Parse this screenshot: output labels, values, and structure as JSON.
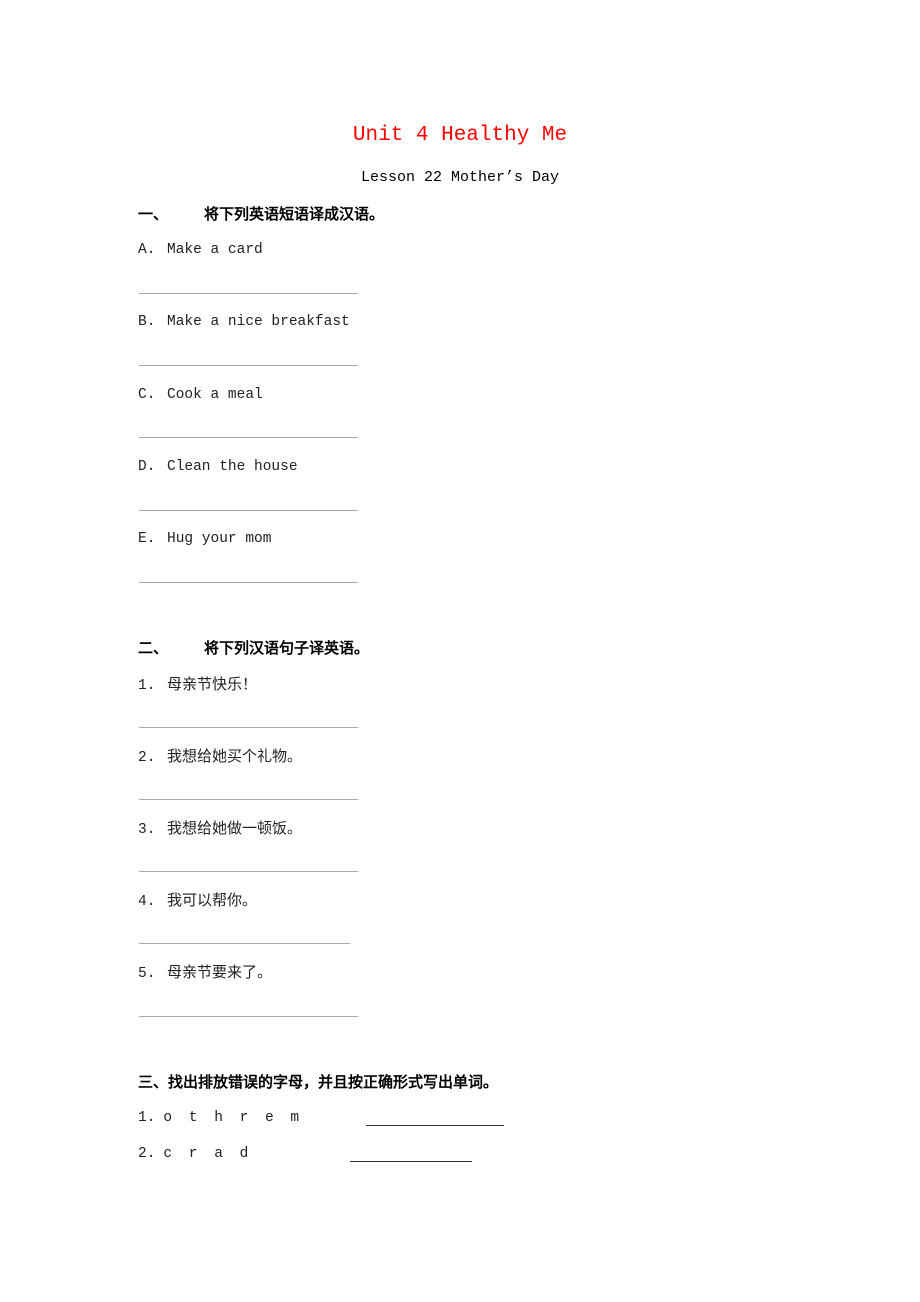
{
  "header": {
    "title": "Unit 4 Healthy Me",
    "title_color": "#ff0000",
    "subtitle": "Lesson 22 Mother’s Day"
  },
  "section1": {
    "number": "一、",
    "instruction": "将下列英语短语译成汉语。",
    "items": [
      {
        "label": "A.",
        "text": "Make a card"
      },
      {
        "label": "B.",
        "text": "Make a nice breakfast"
      },
      {
        "label": "C.",
        "text": "Cook a meal"
      },
      {
        "label": "D.",
        "text": "Clean the house"
      },
      {
        "label": "E.",
        "text": "Hug your mom"
      }
    ]
  },
  "section2": {
    "number": "二、",
    "instruction": "将下列汉语句子译英语。",
    "items": [
      {
        "label": "1.",
        "text": "母亲节快乐！"
      },
      {
        "label": "2.",
        "text": "我想给她买个礼物。"
      },
      {
        "label": "3.",
        "text": "我想给她做一顿饭。"
      },
      {
        "label": "4.",
        "text": "我可以帮你。"
      },
      {
        "label": "5.",
        "text": "母亲节要来了。"
      }
    ]
  },
  "section3": {
    "instruction": "三、找出排放错误的字母，并且按正确形式写出单词。",
    "items": [
      {
        "label": "1.",
        "text": "o t h r e m"
      },
      {
        "label": "2.",
        "text": "c r a d"
      }
    ]
  }
}
